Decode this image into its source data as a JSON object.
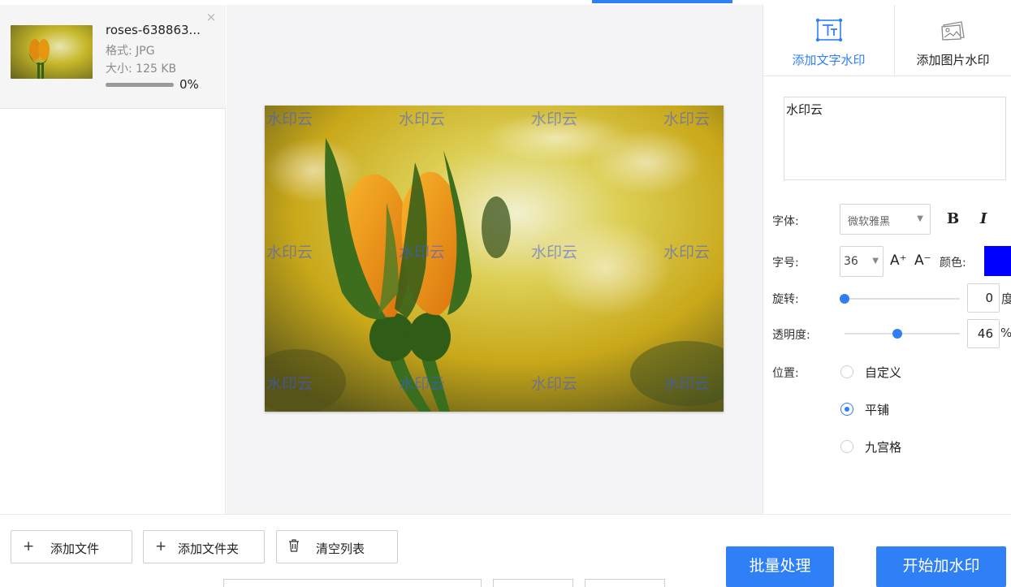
{
  "file": {
    "name": "roses-638863...",
    "format": "格式: JPG",
    "size": "大小: 125 KB",
    "progress_text": "0%",
    "progress": 0,
    "close": "×"
  },
  "preview": {
    "watermark_text": "水印云"
  },
  "tabs": {
    "text_wm": "添加文字水印",
    "image_wm": "添加图片水印"
  },
  "settings": {
    "text_value": "水印云",
    "font_label": "字体:",
    "font_value": "微软雅黑",
    "bold": "B",
    "italic": "I",
    "size_label": "字号:",
    "size_value": "36",
    "size_up": "A⁺",
    "size_down": "A⁻",
    "color_label": "颜色:",
    "color": "#0000ff",
    "rotate_label": "旋转:",
    "rotate_value": "0",
    "rotate_unit": "度",
    "rotate_fraction": 0.0,
    "opacity_label": "透明度:",
    "opacity_value": "46",
    "opacity_unit": "%",
    "opacity_fraction": 0.46,
    "position_label": "位置:",
    "positions": [
      "自定义",
      "平铺",
      "九宫格"
    ],
    "position_selected": "平铺"
  },
  "toolbar": {
    "add_file": "添加文件",
    "add_folder": "添加文件夹",
    "clear_list": "清空列表",
    "plus": "+",
    "trash": "🗑"
  },
  "actions": {
    "batch": "批量处理",
    "start": "开始加水印"
  },
  "colors": {
    "accent": "#2f7ff6",
    "watermark": "#3c5aeb"
  }
}
